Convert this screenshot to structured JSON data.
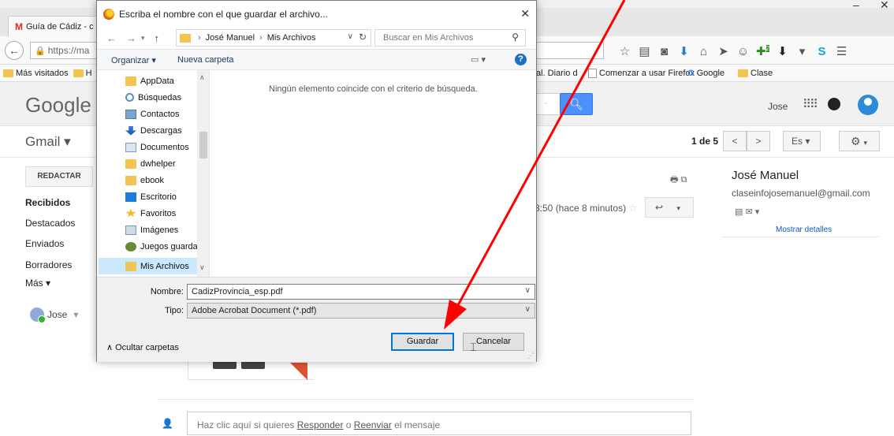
{
  "browser": {
    "tab_title": "Guía de Cádiz - c",
    "tab_favicon_letter": "M",
    "url": "https://ma",
    "minimize_glyph": "–",
    "close_glyph": "✕",
    "back_icon": "back-arrow-icon",
    "toolbar_icons": [
      "star-icon",
      "reader-icon",
      "pocket-icon",
      "download-arrow-icon",
      "home-icon",
      "send-icon",
      "chat-icon",
      "extension-badge-icon",
      "download-icon",
      "skype-icon",
      "menu-icon"
    ],
    "extension_badge": "2",
    "bookmarks": [
      {
        "icon": "folder",
        "label": "Más visitados"
      },
      {
        "icon": "folder",
        "label": "H"
      },
      {
        "icon": "none",
        "label": "al. Diario d"
      },
      {
        "icon": "page",
        "label": "Comenzar a usar Firefox"
      },
      {
        "icon": "google",
        "label": "Google"
      },
      {
        "icon": "folder",
        "label": "Clase"
      }
    ]
  },
  "gmail": {
    "logo": "Google",
    "search_placeholder": "-",
    "user_name": "Jose",
    "section_label": "Gmail ▾",
    "pager": "1 de 5",
    "language_label": "Es",
    "compose_label": "REDACTAR",
    "nav": [
      "Recibidos",
      "Destacados",
      "Enviados",
      "Borradores",
      "Más ▾"
    ],
    "chat_user": "Jose",
    "mail_time": "8:50 (hace 8 minutos)",
    "sender_name": "José Manuel",
    "sender_email": "claseinfojosemanuel@gmail.com",
    "show_details": "Mostrar detalles",
    "reply_prompt": {
      "prefix": "Haz clic aquí si quieres ",
      "reply_link": "Responder",
      "middle": " o ",
      "forward_link": "Reenviar",
      "suffix": " el mensaje"
    }
  },
  "dialog": {
    "title": "Escriba el nombre con el que guardar el archivo...",
    "path": [
      "José Manuel",
      "Mis Archivos"
    ],
    "search_placeholder": "Buscar en Mis Archivos",
    "organize_label": "Organizar ▾",
    "new_folder_label": "Nueva carpeta",
    "empty_message": "Ningún elemento coincide con el criterio de búsqueda.",
    "nav_items": [
      {
        "label": "AppData",
        "icon": "fold"
      },
      {
        "label": "Búsquedas",
        "icon": "srch"
      },
      {
        "label": "Contactos",
        "icon": "cont"
      },
      {
        "label": "Descargas",
        "icon": "down"
      },
      {
        "label": "Documentos",
        "icon": "doc"
      },
      {
        "label": "dwhelper",
        "icon": "fold"
      },
      {
        "label": "ebook",
        "icon": "fold"
      },
      {
        "label": "Escritorio",
        "icon": "desk"
      },
      {
        "label": "Favoritos",
        "icon": "star"
      },
      {
        "label": "Imágenes",
        "icon": "img"
      },
      {
        "label": "Juegos guarda",
        "icon": "game"
      },
      {
        "label": "Mis Archivos",
        "icon": "fold",
        "selected": true
      }
    ],
    "filename_label": "Nombre:",
    "filename_value": "CadizProvincia_esp.pdf",
    "type_label": "Tipo:",
    "type_value": "Adobe Acrobat Document (*.pdf)",
    "hide_folders_label": "Ocultar carpetas",
    "save_label": "Guardar",
    "cancel_label": "Cancelar"
  },
  "annotation": {
    "arrow_color": "#ff0000"
  }
}
